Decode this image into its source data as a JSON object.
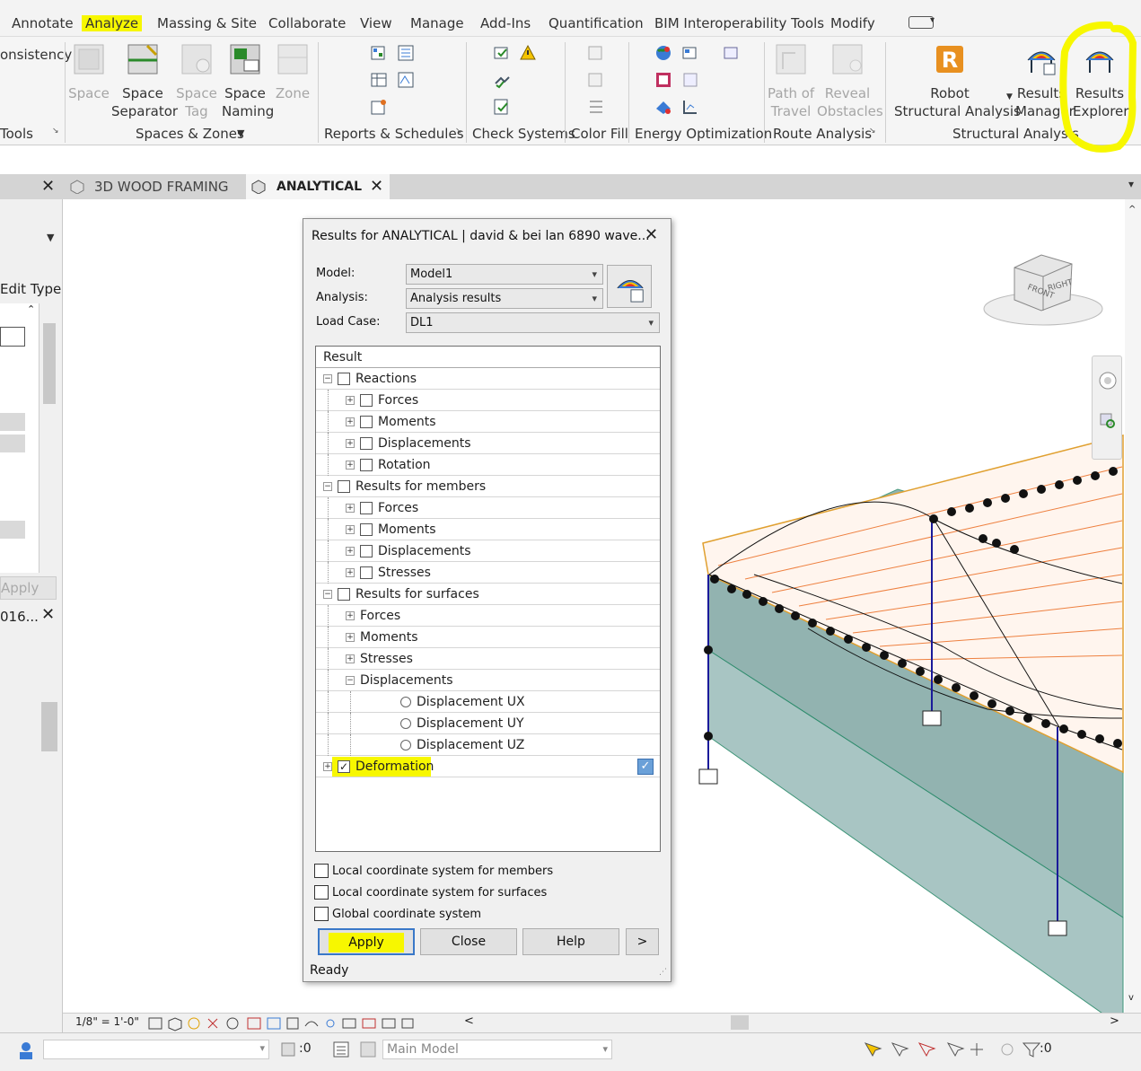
{
  "ribbon": {
    "tabs": [
      "Annotate",
      "Analyze",
      "Massing & Site",
      "Collaborate",
      "View",
      "Manage",
      "Add-Ins",
      "Quantification",
      "BIM Interoperability Tools",
      "Modify"
    ],
    "active_tab": "Analyze",
    "partial_left": "onsistency",
    "panels": {
      "tools": "Tools",
      "spaces_zones": "Spaces & Zones",
      "reports": "Reports & Schedules",
      "check": "Check Systems",
      "color_fill": "Color Fill",
      "energy": "Energy Optimization",
      "route": "Route Analysis",
      "structural": "Structural Analysis"
    },
    "buttons": {
      "space": "Space",
      "space_separator": [
        "Space",
        "Separator"
      ],
      "space_tag": [
        "Space",
        "Tag"
      ],
      "space_naming": [
        "Space",
        "Naming"
      ],
      "zone": "Zone",
      "path_of_travel": [
        "Path of",
        "Travel"
      ],
      "reveal_obstacles": [
        "Reveal",
        "Obstacles"
      ],
      "robot": [
        "Robot",
        "Structural Analysis"
      ],
      "results_manager": [
        "Results",
        "Manager"
      ],
      "results_explorer": [
        "Results",
        "Explorer"
      ]
    },
    "highlight_color": "#f7f700"
  },
  "view_tabs": [
    {
      "label": "3D WOOD FRAMING",
      "active": false
    },
    {
      "label": "ANALYTICAL",
      "active": true
    }
  ],
  "left_palette": {
    "edit_type": "Edit Type",
    "apply": "Apply",
    "partial_label": "016..."
  },
  "viewcube": {
    "front": "FRONT",
    "right": "RIGHT"
  },
  "dialog": {
    "title": "Results for ANALYTICAL | david & bei lan 6890 wave...",
    "model_label": "Model:",
    "model_value": "Model1",
    "analysis_label": "Analysis:",
    "analysis_value": "Analysis results",
    "loadcase_label": "Load Case:",
    "loadcase_value": "DL1",
    "tree_header": "Result",
    "tree": [
      {
        "label": "Reactions",
        "level": 0,
        "expander": "−",
        "control": "checkbox",
        "checked": false
      },
      {
        "label": "Forces",
        "level": 1,
        "expander": "+",
        "control": "checkbox",
        "checked": false
      },
      {
        "label": "Moments",
        "level": 1,
        "expander": "+",
        "control": "checkbox",
        "checked": false
      },
      {
        "label": "Displacements",
        "level": 1,
        "expander": "+",
        "control": "checkbox",
        "checked": false
      },
      {
        "label": "Rotation",
        "level": 1,
        "expander": "+",
        "control": "checkbox",
        "checked": false
      },
      {
        "label": "Results for members",
        "level": 0,
        "expander": "−",
        "control": "checkbox",
        "checked": false
      },
      {
        "label": "Forces",
        "level": 1,
        "expander": "+",
        "control": "checkbox",
        "checked": false
      },
      {
        "label": "Moments",
        "level": 1,
        "expander": "+",
        "control": "checkbox",
        "checked": false
      },
      {
        "label": "Displacements",
        "level": 1,
        "expander": "+",
        "control": "checkbox",
        "checked": false
      },
      {
        "label": "Stresses",
        "level": 1,
        "expander": "+",
        "control": "checkbox",
        "checked": false
      },
      {
        "label": "Results for surfaces",
        "level": 0,
        "expander": "−",
        "control": "checkbox",
        "checked": false
      },
      {
        "label": "Forces",
        "level": 1,
        "expander": "+",
        "control": "none",
        "checked": false
      },
      {
        "label": "Moments",
        "level": 1,
        "expander": "+",
        "control": "none",
        "checked": false
      },
      {
        "label": "Stresses",
        "level": 1,
        "expander": "+",
        "control": "none",
        "checked": false
      },
      {
        "label": "Displacements",
        "level": 1,
        "expander": "−",
        "control": "none",
        "checked": false
      },
      {
        "label": "Displacement UX",
        "level": 2,
        "expander": "",
        "control": "radio",
        "checked": false
      },
      {
        "label": "Displacement UY",
        "level": 2,
        "expander": "",
        "control": "radio",
        "checked": false
      },
      {
        "label": "Displacement UZ",
        "level": 2,
        "expander": "",
        "control": "radio",
        "checked": false
      },
      {
        "label": "Deformation",
        "level": 0,
        "expander": "+",
        "control": "checkbox",
        "checked": true,
        "highlight": true
      }
    ],
    "options": [
      "Local coordinate system for members",
      "Local coordinate system for surfaces",
      "Global coordinate system"
    ],
    "buttons": {
      "apply": "Apply",
      "close": "Close",
      "help": "Help",
      "more": ">"
    },
    "status": "Ready"
  },
  "view_status": {
    "scale": "1/8\" = 1'-0\""
  },
  "app_status": {
    "count": ":0",
    "model": "Main Model",
    "filter": ":0"
  }
}
